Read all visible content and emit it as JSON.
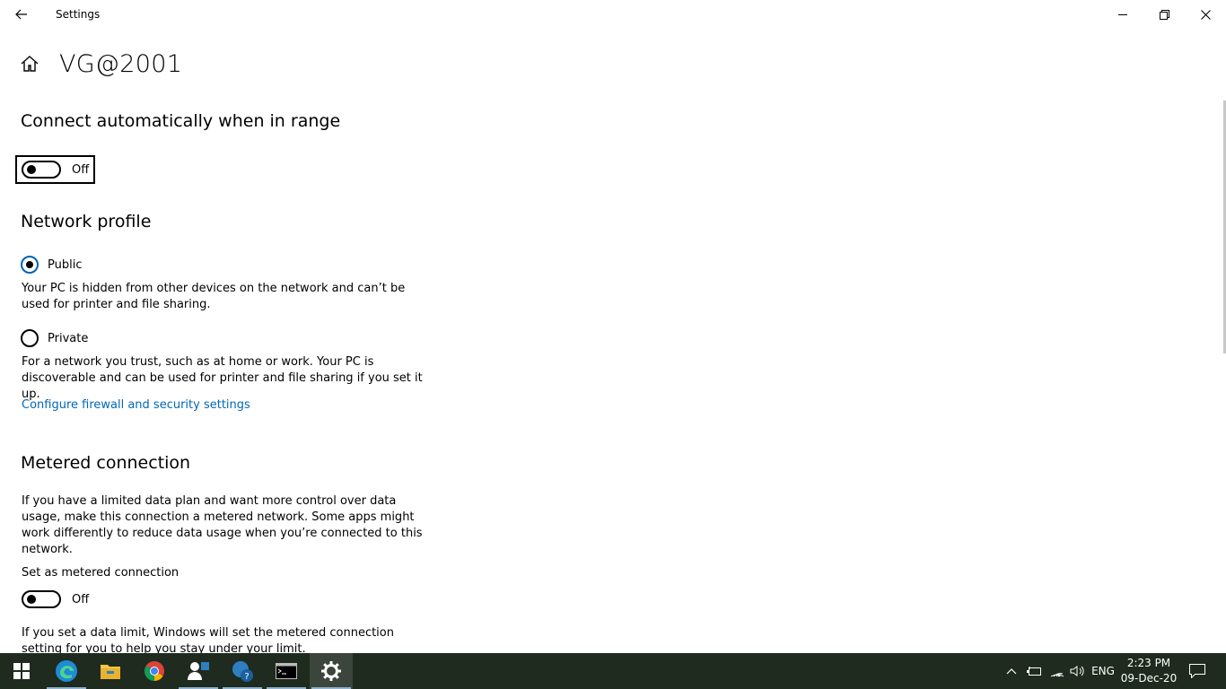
{
  "window": {
    "title": "Settings"
  },
  "page": {
    "title": "VG@2001"
  },
  "auto_connect": {
    "heading": "Connect automatically when in range",
    "toggle_state": "Off"
  },
  "network_profile": {
    "heading": "Network profile",
    "public": {
      "label": "Public",
      "description": "Your PC is hidden from other devices on the network and can’t be used for printer and file sharing.",
      "selected": true
    },
    "private": {
      "label": "Private",
      "description": "For a network you trust, such as at home or work. Your PC is discoverable and can be used for printer and file sharing if you set it up.",
      "selected": false
    },
    "firewall_link": "Configure firewall and security settings"
  },
  "metered": {
    "heading": "Metered connection",
    "description": "If you have a limited data plan and want more control over data usage, make this connection a metered network. Some apps might work differently to reduce data usage when you’re connected to this network.",
    "set_label": "Set as metered connection",
    "toggle_state": "Off",
    "data_limit_text": "If you set a data limit, Windows will set the metered connection setting for you to help you stay under your limit."
  },
  "taskbar": {
    "apps": [
      "start-icon",
      "edge-icon",
      "file-explorer-icon",
      "chrome-icon",
      "people-icon",
      "get-help-icon",
      "terminal-icon",
      "settings-icon"
    ],
    "active_app": "settings-icon",
    "language": "ENG",
    "time": "2:23 PM",
    "date": "09-Dec-20"
  },
  "colors": {
    "accent": "#0063b1",
    "link": "#0067b8",
    "taskbar": "#1f2b1f"
  }
}
